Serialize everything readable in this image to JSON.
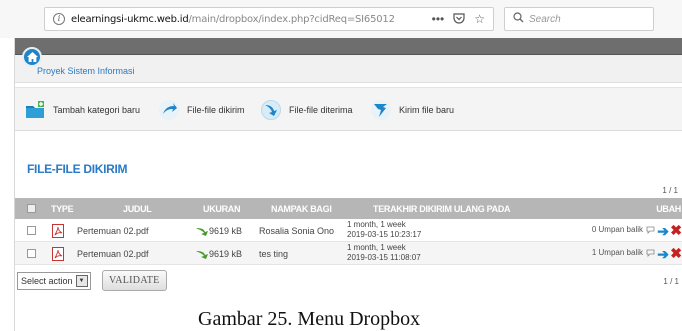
{
  "browser": {
    "url_host": "elearningsi-ukmc.web.id",
    "url_path": "/main/dropbox/index.php?cidReq=SI65012",
    "url_menu_icon": "more-icon",
    "search_placeholder": "Search"
  },
  "breadcrumb": {
    "course": "Proyek Sistem Informasi"
  },
  "toolbar": {
    "items": [
      {
        "label": "Tambah kategori baru",
        "icon": "add-folder-icon",
        "color": "#2e9fd6"
      },
      {
        "label": "File-file dikirim",
        "icon": "upload-icon",
        "color": "#1e86c8"
      },
      {
        "label": "File-file diterima",
        "icon": "download-icon",
        "color": "#1e86c8"
      },
      {
        "label": "Kirim file baru",
        "icon": "send-file-icon",
        "color": "#1e86c8"
      }
    ]
  },
  "section": {
    "title": "FILE-FILE DIKIRIM",
    "pager_top": "1 / 1",
    "pager_bottom": "1 / 1"
  },
  "table": {
    "headers": {
      "type": "TYPE",
      "title": "JUDUL",
      "size": "UKURAN",
      "recipients": "NAMPAK BAGI",
      "last_sent": "TERAKHIR DIKIRIM ULANG PADA",
      "change": "UBAH"
    },
    "rows": [
      {
        "title": "Pertemuan 02.pdf",
        "size": "9619 kB",
        "recipient": "Rosalia Sonia Ono",
        "ago": "1 month, 1 week",
        "date": "2019-03-15 10:23:17",
        "feedback": "0 Umpan balik"
      },
      {
        "title": "Pertemuan 02.pdf",
        "size": "9619 kB",
        "recipient": "tes ting",
        "ago": "1 month, 1 week",
        "date": "2019-03-15 11:08:07",
        "feedback": "1 Umpan balik"
      }
    ]
  },
  "actions": {
    "select_label": "Select action",
    "validate_label": "VALIDATE"
  },
  "caption": "Gambar 25. Menu Dropbox",
  "colors": {
    "accent": "#2a7ac4",
    "header_bg": "#b6b6b6",
    "delete": "#c62020",
    "topbar": "#6e6e6e"
  }
}
